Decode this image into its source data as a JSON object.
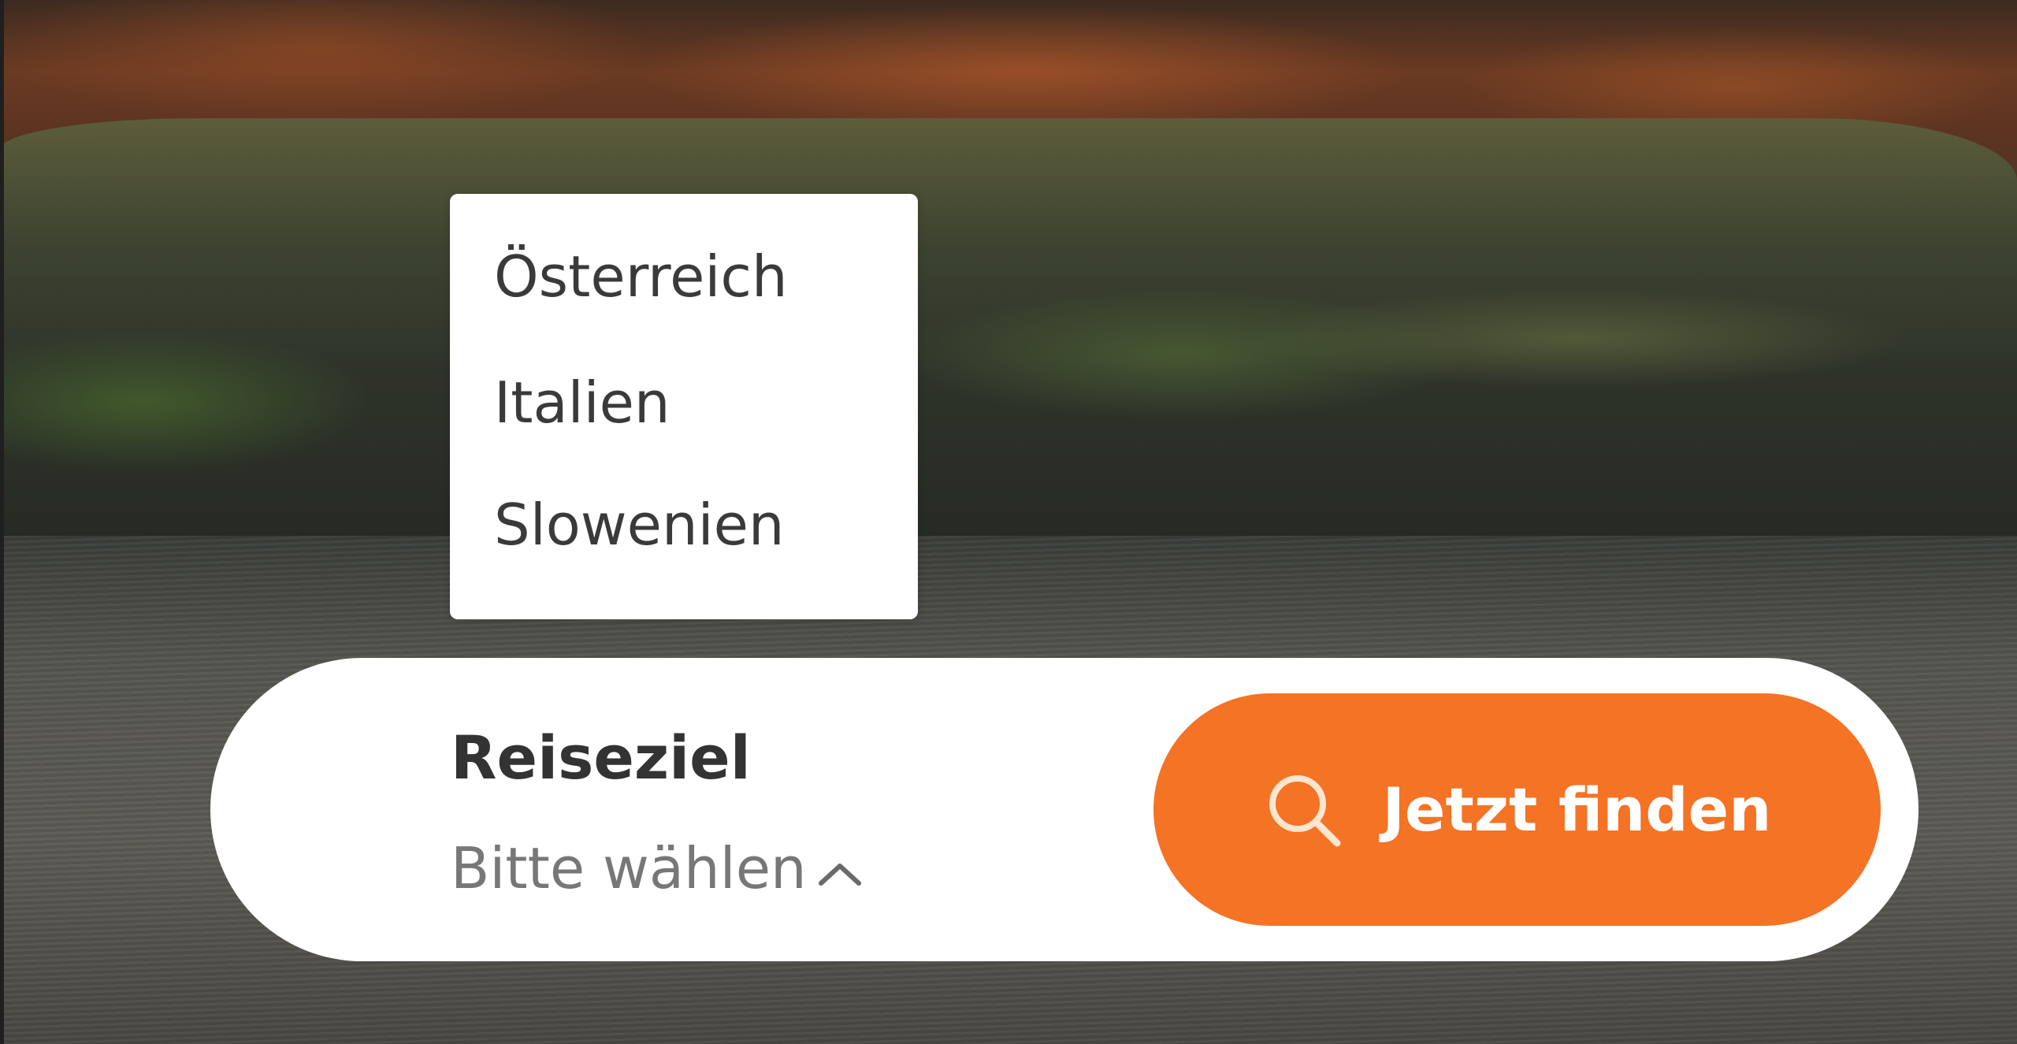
{
  "destination_dropdown": {
    "options": [
      "Österreich",
      "Italien",
      "Slowenien"
    ]
  },
  "search_bar": {
    "field_label": "Reiseziel",
    "field_value": "Bitte wählen",
    "submit_label": "Jetzt finden"
  },
  "icons": {
    "submit": "search-icon",
    "select": "chevron-up-icon"
  },
  "colors": {
    "accent": "#f47325",
    "panel": "#ffffff",
    "text_dark": "#333333",
    "text_muted": "#777777"
  }
}
